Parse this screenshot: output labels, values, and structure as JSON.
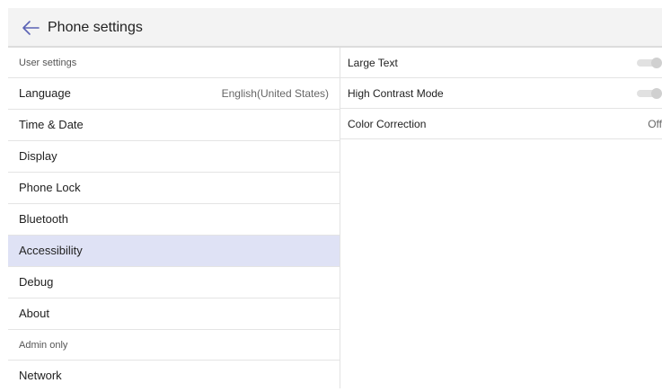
{
  "header": {
    "back_icon": "arrow-left-icon",
    "title": "Phone settings"
  },
  "sidebar": {
    "user_section": "User settings",
    "items": [
      {
        "label": "Language",
        "value": "English(United States)"
      },
      {
        "label": "Time & Date"
      },
      {
        "label": "Display"
      },
      {
        "label": "Phone Lock"
      },
      {
        "label": "Bluetooth"
      },
      {
        "label": "Accessibility",
        "selected": true
      },
      {
        "label": "Debug"
      },
      {
        "label": "About"
      }
    ],
    "admin_section": "Admin only",
    "admin_items": [
      {
        "label": "Network"
      }
    ]
  },
  "accessibility": {
    "large_text": {
      "label": "Large Text",
      "enabled": false
    },
    "high_contrast": {
      "label": "High Contrast Mode",
      "enabled": false
    },
    "color_correction": {
      "label": "Color Correction",
      "value": "Off"
    }
  },
  "colors": {
    "selected_row": "#dfe2f5",
    "header_bg": "#f3f3f3"
  }
}
